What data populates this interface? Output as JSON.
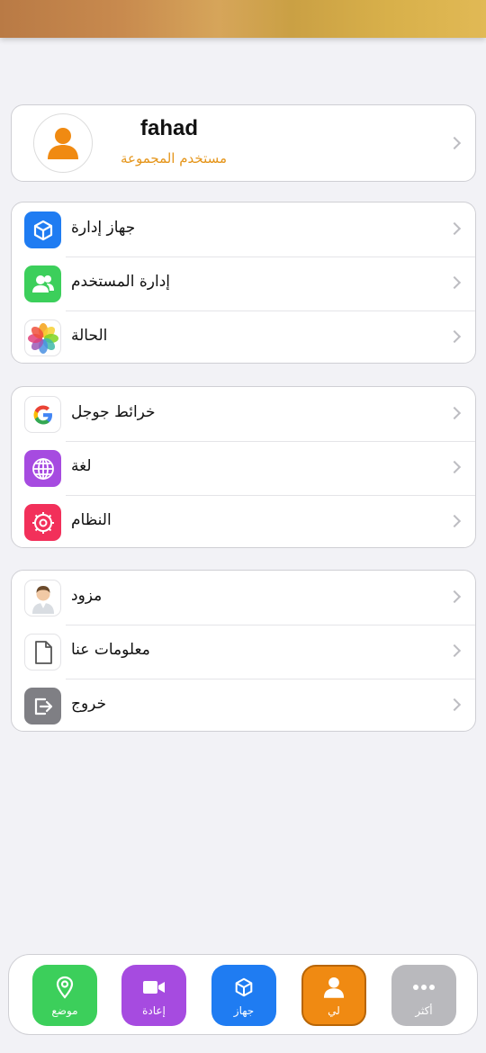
{
  "profile": {
    "name": "fahad",
    "role": "مستخدم المجموعة"
  },
  "groups": [
    {
      "items": [
        {
          "label": "جهاز إدارة",
          "icon": "box-icon",
          "color": "#1f7cf2"
        },
        {
          "label": "إدارة المستخدم",
          "icon": "users-icon",
          "color": "#3ccf5b"
        },
        {
          "label": "الحالة",
          "icon": "photos-flower-icon",
          "color": "#ffffff"
        }
      ]
    },
    {
      "items": [
        {
          "label": "خرائط جوجل",
          "icon": "google-icon",
          "color": "#ffffff"
        },
        {
          "label": "لغة",
          "icon": "globe-icon",
          "color": "#a64be0"
        },
        {
          "label": "النظام",
          "icon": "settings-gear-icon",
          "color": "#f2305a"
        }
      ]
    },
    {
      "items": [
        {
          "label": "مزود",
          "icon": "provider-avatar-icon",
          "color": "#ffffff"
        },
        {
          "label": "معلومات عنا",
          "icon": "document-icon",
          "color": "#ffffff"
        },
        {
          "label": "خروج",
          "icon": "logout-icon",
          "color": "#7f7f84"
        }
      ]
    }
  ],
  "tabbar": {
    "tabs": [
      {
        "label": "موضع",
        "icon": "location-pin-icon",
        "color": "#3ccf5b"
      },
      {
        "label": "إعادة",
        "icon": "video-camera-icon",
        "color": "#a64be0"
      },
      {
        "label": "جهاز",
        "icon": "box-icon",
        "color": "#1f7cf2"
      },
      {
        "label": "لي",
        "icon": "person-icon",
        "color": "#f08a12"
      },
      {
        "label": "أكثر",
        "icon": "more-dots-icon",
        "color": "#b9b9bd"
      }
    ]
  }
}
